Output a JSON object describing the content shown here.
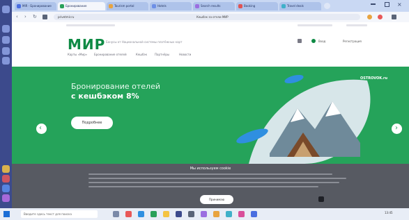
{
  "browser": {
    "tabs": [
      {
        "label": "MIR - Бронирование",
        "favicon_color": "#4a6ee0"
      },
      {
        "label": "Бронирование",
        "favicon_color": "#2aa15a",
        "active": true
      },
      {
        "label": "Tourism portal",
        "favicon_color": "#e8a440"
      },
      {
        "label": "Hotels",
        "favicon_color": "#6d8fe6"
      },
      {
        "label": "Search results",
        "favicon_color": "#9b6ee0"
      },
      {
        "label": "Booking",
        "favicon_color": "#e05353"
      },
      {
        "label": "Travel deals",
        "favicon_color": "#3fb0c9"
      }
    ],
    "url": "privetmir.ru",
    "page_header_text": "Кешбэк за отели МИР"
  },
  "site": {
    "logo_text": "МИР",
    "tagline": "Бонусы от Национальной системы платёжных карт",
    "nav_items": [
      "Карты «Мир»",
      "Бронирование отелей",
      "Кешбэк",
      "Партнёры",
      "Новости"
    ],
    "header_links": [
      "Вход",
      "Регистрация"
    ]
  },
  "banner": {
    "title_line1": "Бронирование отелей",
    "title_line2": "с кешбэком 8%",
    "button_label": "Подробнее",
    "partner_logo": "OSTROVOK.ru",
    "bg_color": "#25a35a"
  },
  "cookie": {
    "title": "Мы используем cookie",
    "accept_label": "Принимаю"
  },
  "taskbar": {
    "search_placeholder": "Введите здесь текст для поиска",
    "time": "13:45"
  }
}
